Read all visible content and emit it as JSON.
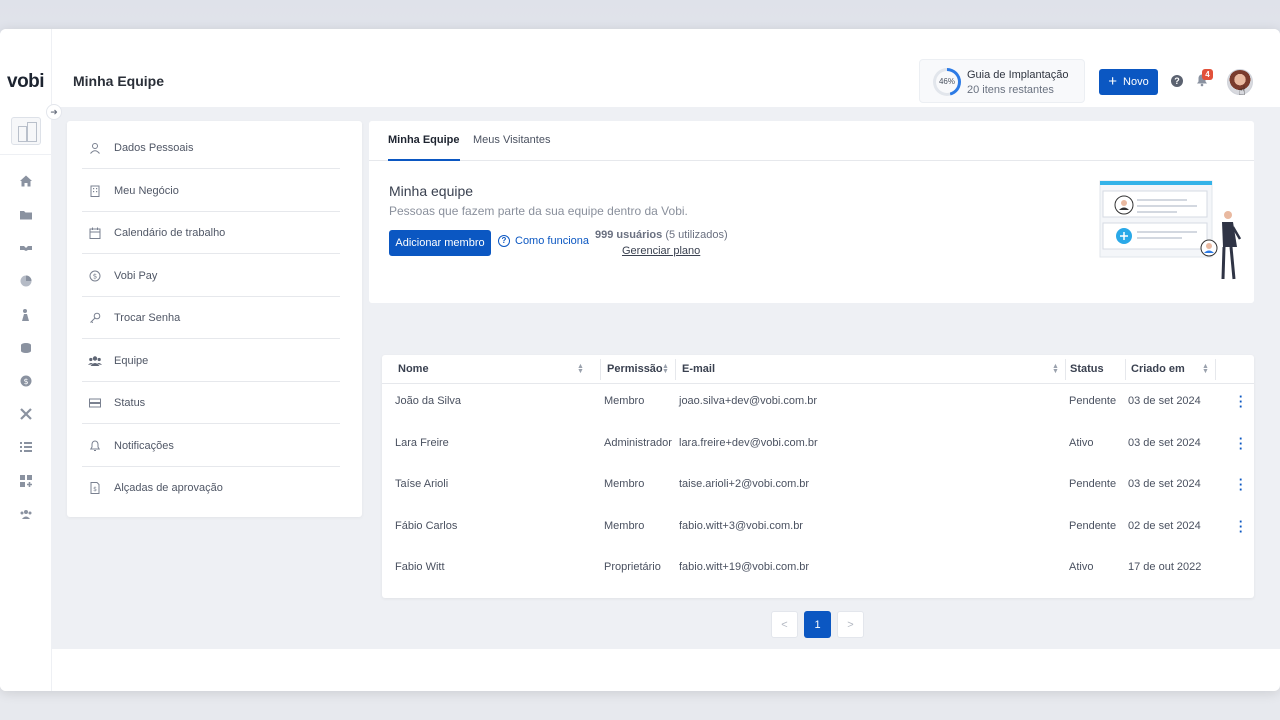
{
  "app": {
    "logo": "vobi",
    "page_title": "Minha Equipe"
  },
  "header": {
    "guide": {
      "percent": "46%",
      "title": "Guia de Implantação",
      "subtitle": "20 itens restantes",
      "progress": 0.46
    },
    "new_button": "Novo",
    "notifications_count": "4",
    "help_icon": "question-circle-icon",
    "bell_icon": "bell-icon"
  },
  "rail": {
    "icons": [
      "home-icon",
      "folder-icon",
      "handshake-icon",
      "chart-icon",
      "worker-icon",
      "coins-icon",
      "dollar-icon",
      "tools-icon",
      "list-icon",
      "apps-icon",
      "team-icon"
    ]
  },
  "settings_menu": {
    "items": [
      {
        "label": "Dados Pessoais",
        "icon": "user-icon"
      },
      {
        "label": "Meu Negócio",
        "icon": "building-icon"
      },
      {
        "label": "Calendário de trabalho",
        "icon": "calendar-icon"
      },
      {
        "label": "Vobi Pay",
        "icon": "dollar-circle-icon"
      },
      {
        "label": "Trocar Senha",
        "icon": "key-icon"
      },
      {
        "label": "Equipe",
        "icon": "team-icon"
      },
      {
        "label": "Status",
        "icon": "status-icon"
      },
      {
        "label": "Notificações",
        "icon": "bell-icon"
      },
      {
        "label": "Alçadas de aprovação",
        "icon": "document-dollar-icon"
      }
    ]
  },
  "tabs": {
    "active": "Minha Equipe",
    "other": "Meus Visitantes"
  },
  "team": {
    "title": "Minha equipe",
    "subtitle": "Pessoas que fazem parte da sua equipe dentro da Vobi.",
    "add_button": "Adicionar membro",
    "how_it_works": "Como funciona",
    "users_bold": "999 usuários",
    "users_used": "(5 utilizados)",
    "manage_plan": "Gerenciar plano"
  },
  "table": {
    "headers": {
      "name": "Nome",
      "permission": "Permissão",
      "email": "E-mail",
      "status": "Status",
      "created": "Criado em"
    },
    "rows": [
      {
        "name": "João da Silva",
        "permission": "Membro",
        "email": "joao.silva+dev@vobi.com.br",
        "status": "Pendente",
        "created": "03 de set 2024",
        "menu": true
      },
      {
        "name": "Lara Freire",
        "permission": "Administrador",
        "email": "lara.freire+dev@vobi.com.br",
        "status": "Ativo",
        "created": "03 de set 2024",
        "menu": true
      },
      {
        "name": "Taíse Arioli",
        "permission": "Membro",
        "email": "taise.arioli+2@vobi.com.br",
        "status": "Pendente",
        "created": "03 de set 2024",
        "menu": true
      },
      {
        "name": "Fábio Carlos",
        "permission": "Membro",
        "email": "fabio.witt+3@vobi.com.br",
        "status": "Pendente",
        "created": "02 de set 2024",
        "menu": true
      },
      {
        "name": "Fabio Witt",
        "permission": "Proprietário",
        "email": "fabio.witt+19@vobi.com.br",
        "status": "Ativo",
        "created": "17 de out 2022",
        "menu": false
      }
    ]
  },
  "pagination": {
    "prev": "<",
    "current": "1",
    "next": ">"
  },
  "colors": {
    "primary": "#0b57c2",
    "badge": "#e2513a",
    "background": "#eef0f4"
  }
}
